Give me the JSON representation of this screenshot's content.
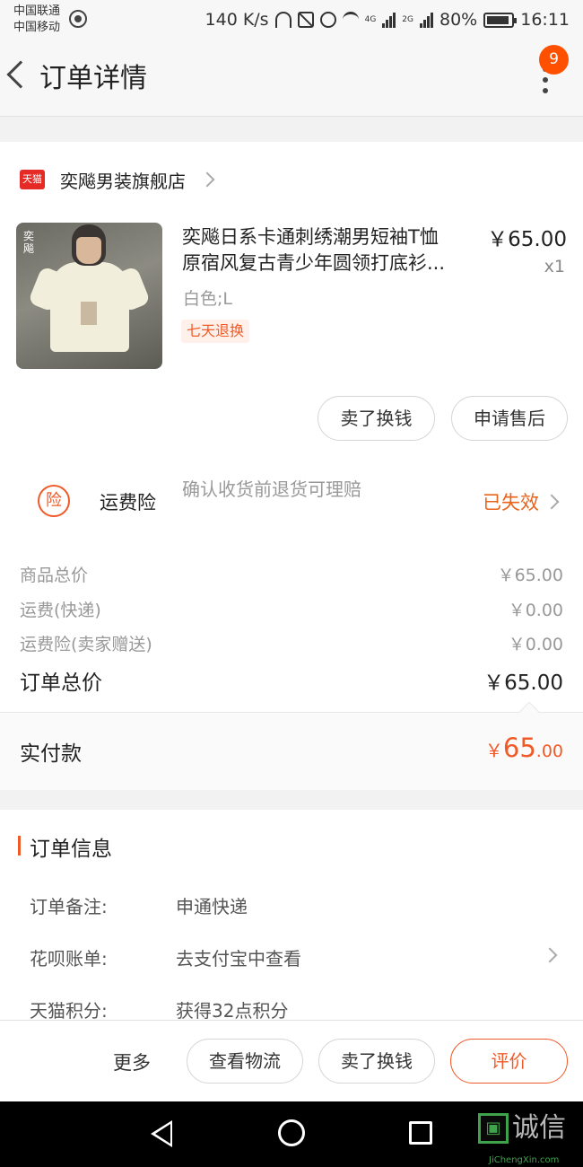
{
  "status_bar": {
    "carrier_1": "中国联通",
    "carrier_2": "中国移动",
    "speed": "140 K/s",
    "net_4g": "4G",
    "net_2g": "2G",
    "battery": "80%",
    "time": "16:11"
  },
  "header": {
    "title": "订单详情",
    "badge": "9"
  },
  "shop": {
    "badge_label": "天猫",
    "name": "奕飚男装旗舰店"
  },
  "product": {
    "title_line1": "奕飚日系卡通刺绣潮男短袖T恤",
    "title_line2": "原宿风复古青少年圆领打底衫...",
    "price": "￥65.00",
    "qty": "x1",
    "sku": "白色;L",
    "tag": "七天退换",
    "image_text": "奕飚"
  },
  "product_actions": {
    "sell": "卖了换钱",
    "after_sale": "申请售后"
  },
  "insurance": {
    "icon_text": "险",
    "title": "运费险",
    "desc": "确认收货前退货可理赔",
    "status": "已失效",
    "status_color": "#e8641c"
  },
  "costs": [
    {
      "label": "商品总价",
      "value": "￥65.00"
    },
    {
      "label": "运费(快递)",
      "value": "￥0.00"
    },
    {
      "label": "运费险(卖家赠送)",
      "value": "￥0.00"
    },
    {
      "label": "订单总价",
      "value": "￥65.00"
    }
  ],
  "paid": {
    "label": "实付款",
    "symbol": "￥",
    "integer": "65",
    "decimal": ".00"
  },
  "order_info": {
    "title": "订单信息",
    "rows": [
      {
        "label": "订单备注:",
        "value": "申通快递"
      },
      {
        "label": "花呗账单:",
        "value": "去支付宝中查看"
      },
      {
        "label": "天猫积分:",
        "value": "获得32点积分"
      }
    ]
  },
  "action_bar": {
    "more": "更多",
    "logistics": "查看物流",
    "sell": "卖了换钱",
    "review": "评价"
  },
  "watermark": {
    "text": "诚信",
    "sub": "JiChengXin.com"
  },
  "colors": {
    "accent": "#f05a28",
    "badge": "#ff5000",
    "tmall_red": "#e62b26"
  }
}
